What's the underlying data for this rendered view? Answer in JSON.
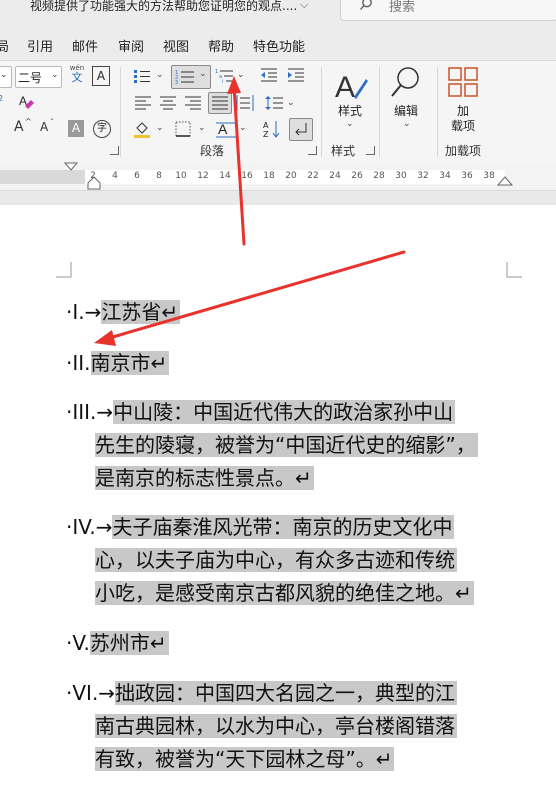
{
  "title_bar": {
    "doc_hint": "视频提供了功能强大的方法帮助您证明您的观点....",
    "search_placeholder": "搜索"
  },
  "menu": {
    "tabs": [
      "局",
      "引用",
      "邮件",
      "审阅",
      "视图",
      "帮助",
      "特色功能"
    ]
  },
  "ribbon": {
    "font_size_value": "二号",
    "phonetic_label": "wén",
    "phonetic_char": "文",
    "boxed_char": "A",
    "grow_font": "A",
    "shrink_font": "A",
    "shaded_char": "A",
    "enclosed_char": "字",
    "paragraph_label": "段落",
    "style_label": "样式",
    "styles_button": "样式",
    "edit_button": "编辑",
    "addin_button_line1": "加",
    "addin_button_line2": "载项",
    "addin_group_label": "加载项",
    "small_indicator": "2"
  },
  "ruler": {
    "numbers": [
      "2",
      "4",
      "6",
      "8",
      "10",
      "12",
      "14",
      "16",
      "18",
      "20",
      "22",
      "24",
      "26",
      "28",
      "30",
      "32",
      "34",
      "36",
      "38"
    ]
  },
  "document": {
    "items": [
      {
        "marker": "·I.→",
        "lines": [
          "江苏省↵"
        ]
      },
      {
        "marker": "·II.",
        "lines": [
          "南京市↵"
        ]
      },
      {
        "marker": "·III.→",
        "lines": [
          "中山陵：中国近代伟大的政治家孙中山",
          "先生的陵寝，被誉为“中国近代史的缩影”，",
          "是南京的标志性景点。↵"
        ]
      },
      {
        "marker": "·IV.→",
        "lines": [
          "夫子庙秦淮风光带：南京的历史文化中",
          "心，以夫子庙为中心，有众多古迹和传统",
          "小吃，是感受南京古都风貌的绝佳之地。↵"
        ]
      },
      {
        "marker": "·V.",
        "lines": [
          "苏州市↵"
        ]
      },
      {
        "marker": "·VI.→",
        "lines": [
          "拙政园：中国四大名园之一，典型的江",
          "南古典园林，以水为中心，亭台楼阁错落",
          "有致，被誉为“天下园林之母”。↵"
        ]
      }
    ]
  },
  "annotation": {
    "arrow_color": "#e8322c"
  }
}
